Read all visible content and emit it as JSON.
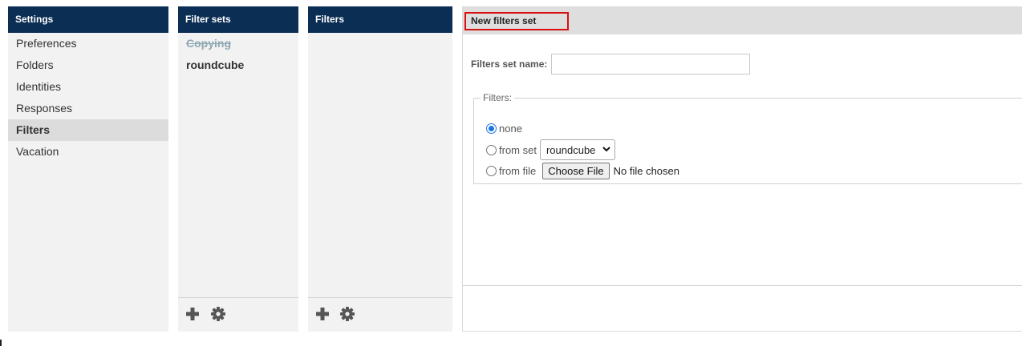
{
  "settings": {
    "header": "Settings",
    "items": [
      {
        "label": "Preferences",
        "selected": false
      },
      {
        "label": "Folders",
        "selected": false
      },
      {
        "label": "Identities",
        "selected": false
      },
      {
        "label": "Responses",
        "selected": false
      },
      {
        "label": "Filters",
        "selected": true
      },
      {
        "label": "Vacation",
        "selected": false
      }
    ]
  },
  "filter_sets": {
    "header": "Filter sets",
    "items": [
      {
        "label": "Copying",
        "state": "disabled"
      },
      {
        "label": "roundcube",
        "state": "active"
      }
    ],
    "footer": {
      "add_icon": "plus-icon",
      "options_icon": "gear-icon"
    }
  },
  "filters": {
    "header": "Filters",
    "footer": {
      "add_icon": "plus-icon",
      "options_icon": "gear-icon"
    }
  },
  "editor": {
    "title": "New filters set",
    "name_label": "Filters set name:",
    "name_value": "",
    "fieldset_legend": "Filters:",
    "option_none": "none",
    "option_from_set": "from set",
    "from_set_selected": "roundcube",
    "option_from_file": "from file",
    "choose_file_label": "Choose File",
    "no_file_text": "No file chosen",
    "selected_option": "none"
  },
  "colors": {
    "header_bg": "#0b2e54",
    "panel_bg": "#f2f2f2",
    "selected_bg": "#dcdcdc",
    "highlight_border": "#d81010",
    "radio_checked": "#1a73e8"
  }
}
